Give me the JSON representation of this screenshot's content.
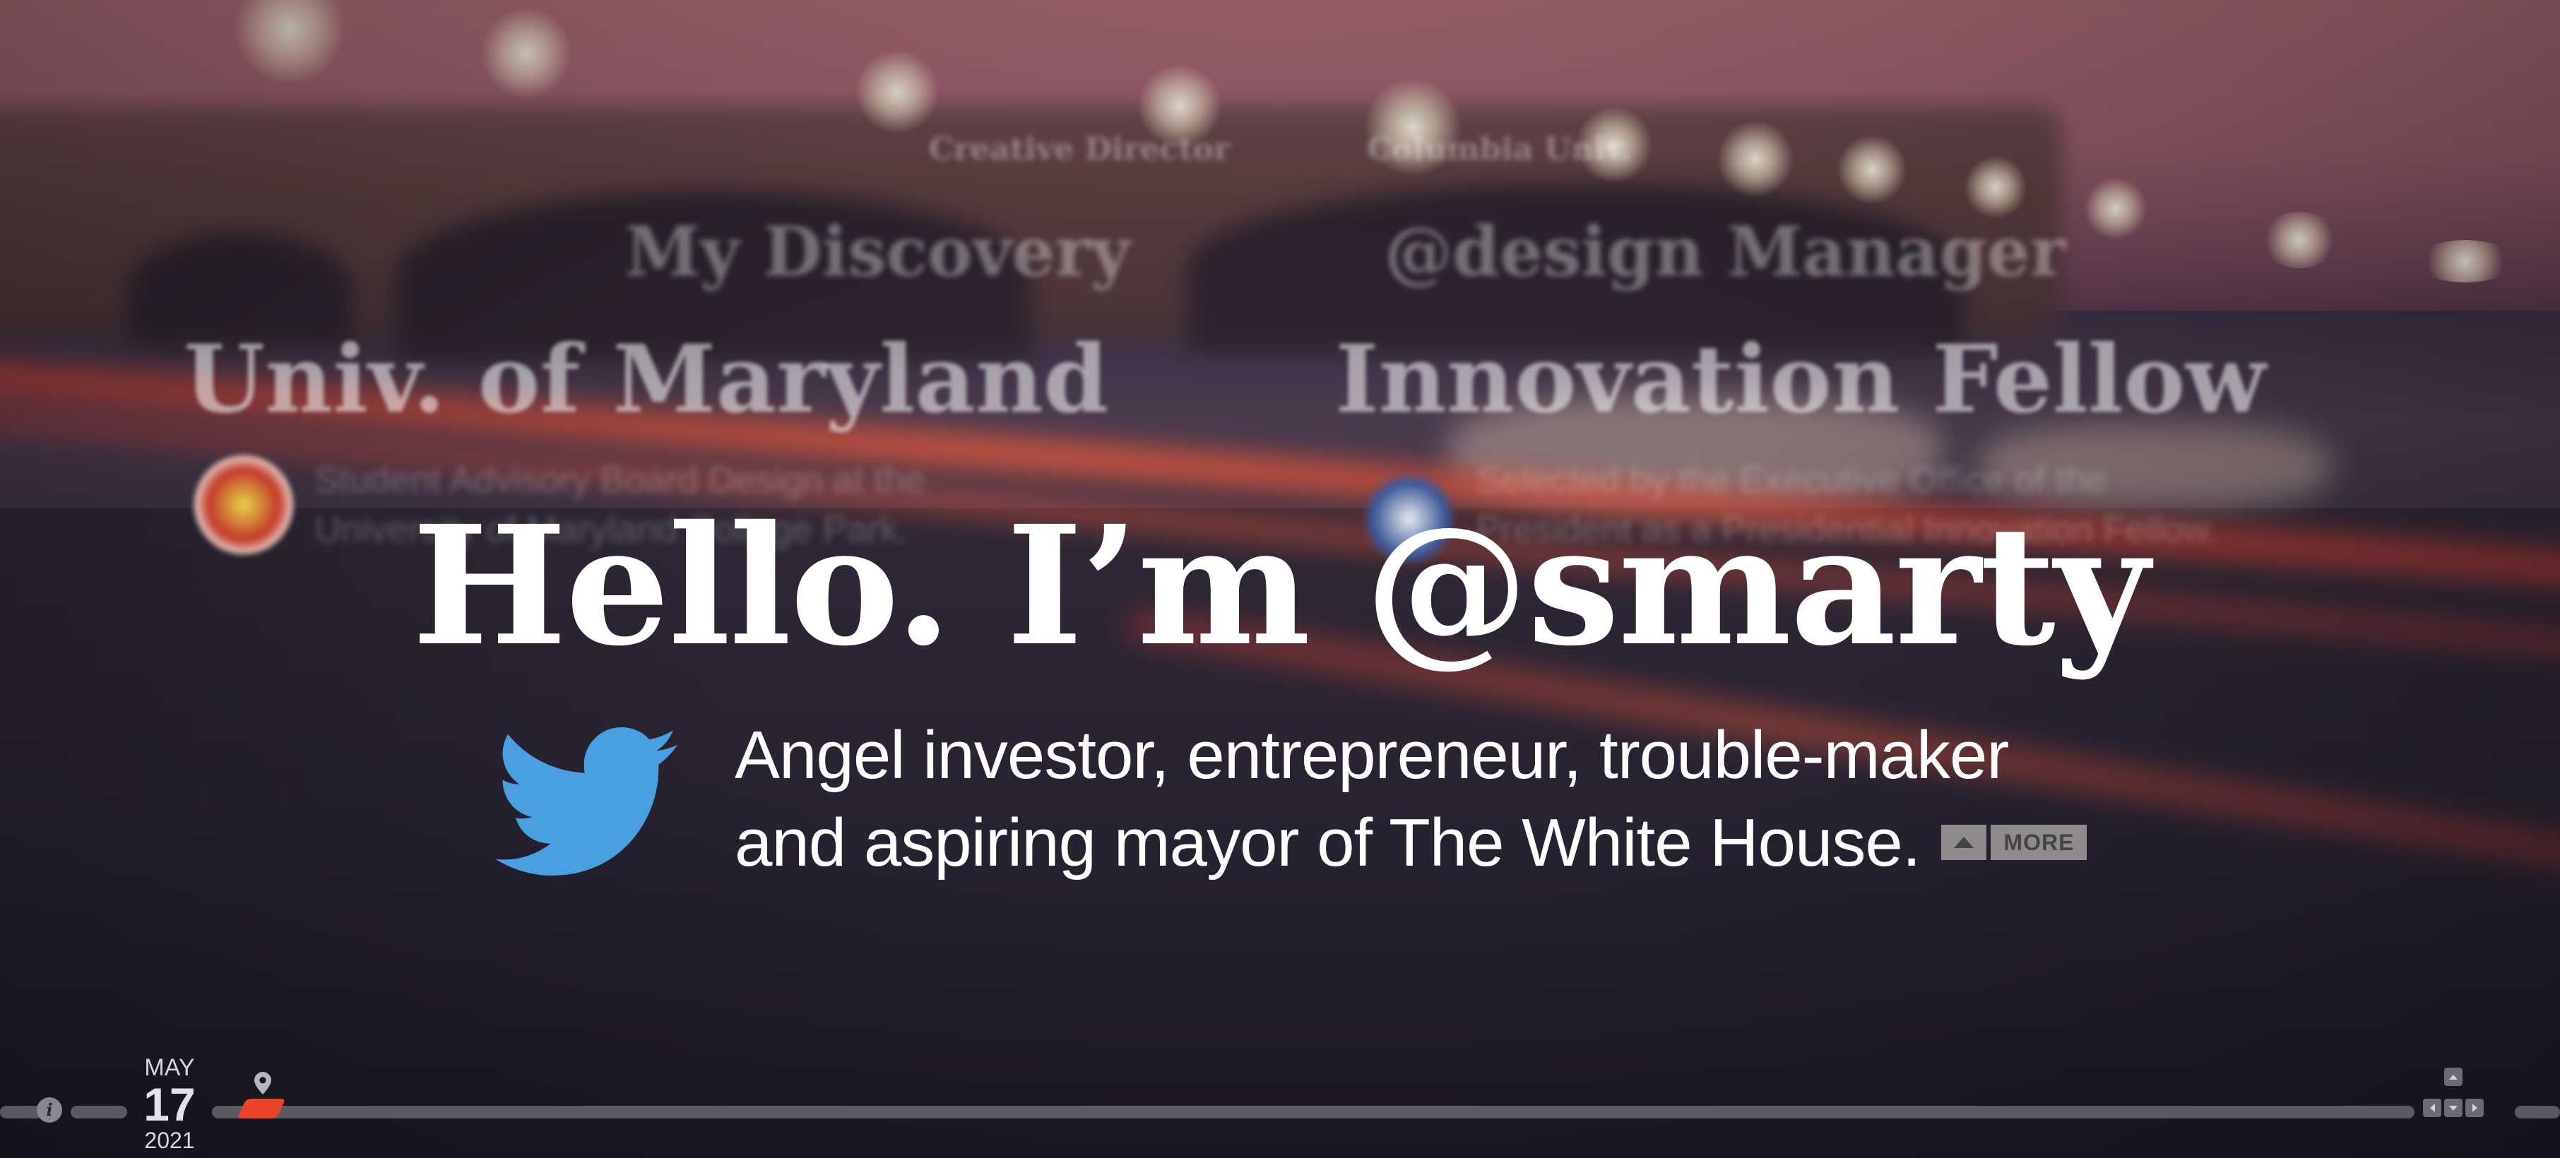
{
  "colors": {
    "twitter_blue": "#4a9fe0",
    "timeline_marker": "#e8452b",
    "more_button_bg": "#8f8b8d"
  },
  "background_cards": {
    "left": {
      "role": "Creative Director",
      "subtitle": "My Discovery",
      "title": "Univ. of Maryland",
      "description_line1": "Student Advisory Board Design at the",
      "description_line2": "University of Maryland College Park."
    },
    "right": {
      "role": "Columbia Univ.",
      "subtitle": "@design Manager",
      "title": "Innovation Fellow",
      "description_line1": "Selected by the Executive Office of the",
      "description_line2": "President as a Presidential Innovation Fellow."
    }
  },
  "hero": {
    "heading": "Hello. I’m @smarty",
    "tagline_line1": "Angel investor, entrepreneur, trouble-maker",
    "tagline_line2": "and aspiring mayor of The White House.",
    "more_label": "MORE",
    "icon": "twitter-bird-icon"
  },
  "timeline": {
    "month": "MAY",
    "day": "17",
    "year": "2021",
    "info_icon": "info-icon",
    "location_icon": "map-pin-icon",
    "nav_icons": [
      "arrow-up-icon",
      "arrow-left-icon",
      "arrow-down-icon",
      "arrow-right-icon"
    ]
  }
}
